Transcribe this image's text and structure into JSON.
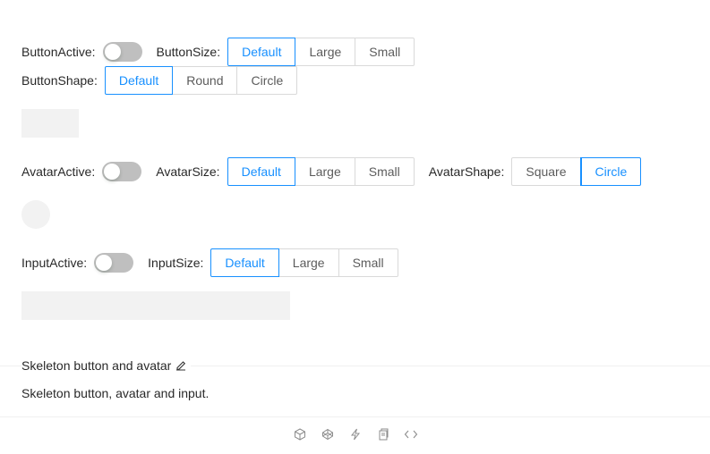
{
  "button_controls": {
    "active_label": "ButtonActive:",
    "size_label": "ButtonSize:",
    "size_options": [
      "Default",
      "Large",
      "Small"
    ],
    "size_selected": "Default",
    "shape_label": "ButtonShape:",
    "shape_options": [
      "Default",
      "Round",
      "Circle"
    ],
    "shape_selected": "Default"
  },
  "avatar_controls": {
    "active_label": "AvatarActive:",
    "size_label": "AvatarSize:",
    "size_options": [
      "Default",
      "Large",
      "Small"
    ],
    "size_selected": "Default",
    "shape_label": "AvatarShape:",
    "shape_options": [
      "Square",
      "Circle"
    ],
    "shape_selected": "Circle"
  },
  "input_controls": {
    "active_label": "InputActive:",
    "size_label": "InputSize:",
    "size_options": [
      "Default",
      "Large",
      "Small"
    ],
    "size_selected": "Default"
  },
  "demo_meta": {
    "title": "Skeleton button and avatar",
    "description": "Skeleton button, avatar and input."
  },
  "colors": {
    "accent": "#1890ff",
    "skeleton": "#f2f2f2",
    "switch_off": "#bfbfbf"
  },
  "action_icons": [
    "codesandbox-icon",
    "codepen-icon",
    "riddle-icon",
    "copy-icon",
    "expand-code-icon"
  ]
}
